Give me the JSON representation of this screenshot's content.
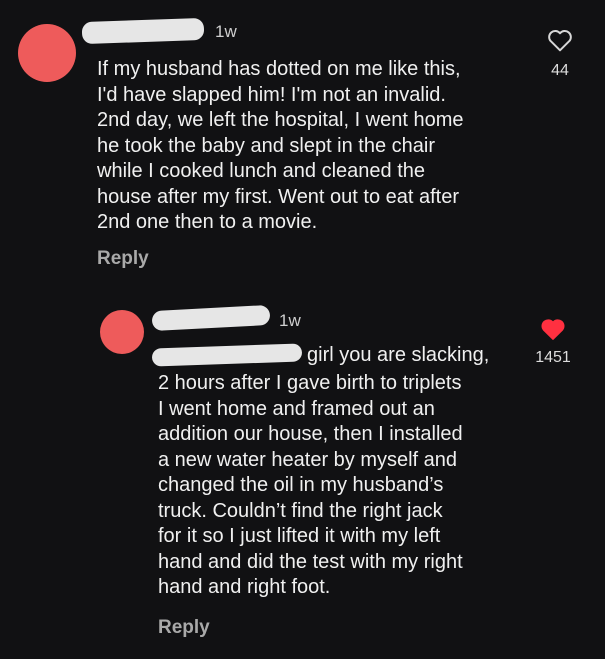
{
  "comments": [
    {
      "time": "1w",
      "text": "If my husband has dotted on me like this,\nI'd have slapped him! I'm not an invalid.\n2nd day,  we left the hospital,  I went home\nhe took the baby and slept in the chair\nwhile I cooked lunch and cleaned the\nhouse after my first.  Went out to eat after\n2nd one then to a movie.",
      "reply_label": "Reply",
      "like_count": "44",
      "liked": false
    },
    {
      "time": "1w",
      "first_line": "girl you are slacking,",
      "text": "2 hours after I gave birth to triplets\nI went home and framed out an\naddition our house, then I installed\na new water heater by myself and\nchanged the oil in my husband’s\ntruck. Couldn’t find the right jack\nfor it so I just lifted it with my left\nhand and did the test with my right\nhand and right foot.",
      "reply_label": "Reply",
      "like_count": "1451",
      "liked": true
    }
  ],
  "colors": {
    "background": "#111113",
    "avatar": "#ee5b5b",
    "liked_heart": "#ff3040"
  }
}
